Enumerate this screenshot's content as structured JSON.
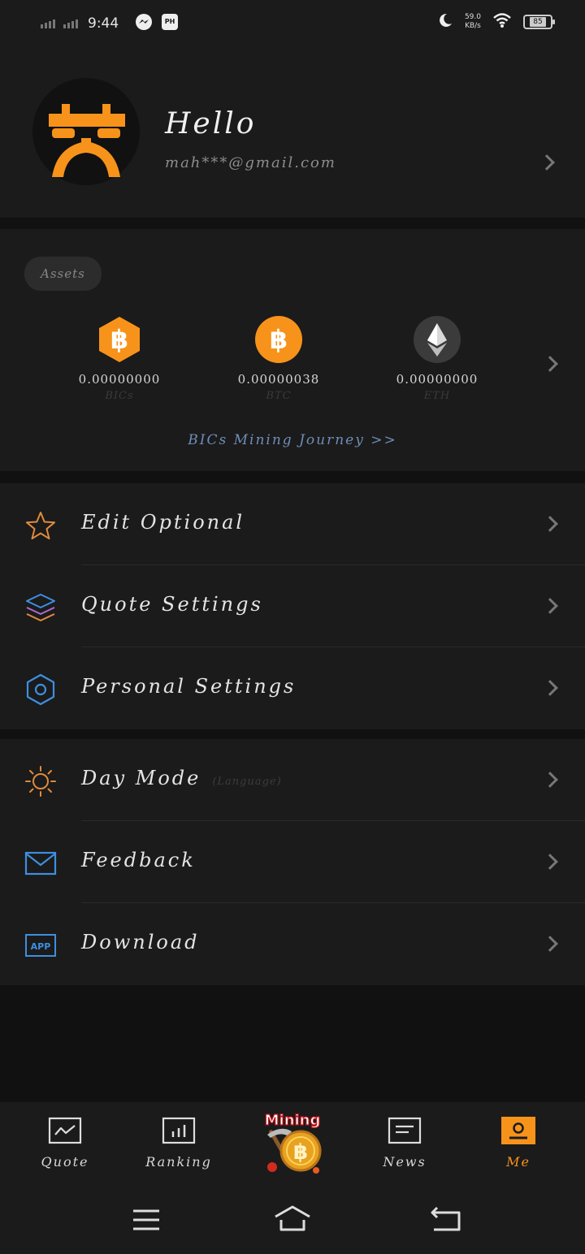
{
  "status_bar": {
    "time": "9:44",
    "app_badge": "PH",
    "speed_value": "59.0",
    "speed_unit": "KB/s",
    "battery": "85"
  },
  "profile": {
    "greeting": "Hello",
    "email": "mah***@gmail.com"
  },
  "assets": {
    "badge": "Assets",
    "coins": [
      {
        "value": "0.00000000",
        "name": "BICs",
        "icon": "bics-hexagon-icon"
      },
      {
        "value": "0.00000038",
        "name": "BTC",
        "icon": "bitcoin-icon"
      },
      {
        "value": "0.00000000",
        "name": "ETH",
        "icon": "ethereum-icon"
      }
    ],
    "journey_link": "BICs Mining Journey >>"
  },
  "menu_group_1": [
    {
      "label": "Edit Optional",
      "icon": "star-icon"
    },
    {
      "label": "Quote Settings",
      "icon": "layers-icon"
    },
    {
      "label": "Personal Settings",
      "icon": "hexagon-settings-icon"
    }
  ],
  "menu_group_2": [
    {
      "label": "Day Mode",
      "sub": "(Language)",
      "icon": "sun-icon"
    },
    {
      "label": "Feedback",
      "icon": "mail-icon"
    },
    {
      "label": "Download",
      "icon": "app-icon",
      "icon_text": "APP"
    }
  ],
  "tabbar": {
    "tabs": [
      {
        "label": "Quote",
        "icon": "chart-icon"
      },
      {
        "label": "Ranking",
        "icon": "bar-chart-icon"
      },
      {
        "label": "Mining",
        "icon": "mining-bitcoin-icon"
      },
      {
        "label": "News",
        "icon": "news-icon"
      },
      {
        "label": "Me",
        "icon": "profile-icon",
        "active": true
      }
    ]
  },
  "colors": {
    "accent": "#f7931a",
    "background": "#1b1b1b",
    "link": "#6f8db8"
  }
}
